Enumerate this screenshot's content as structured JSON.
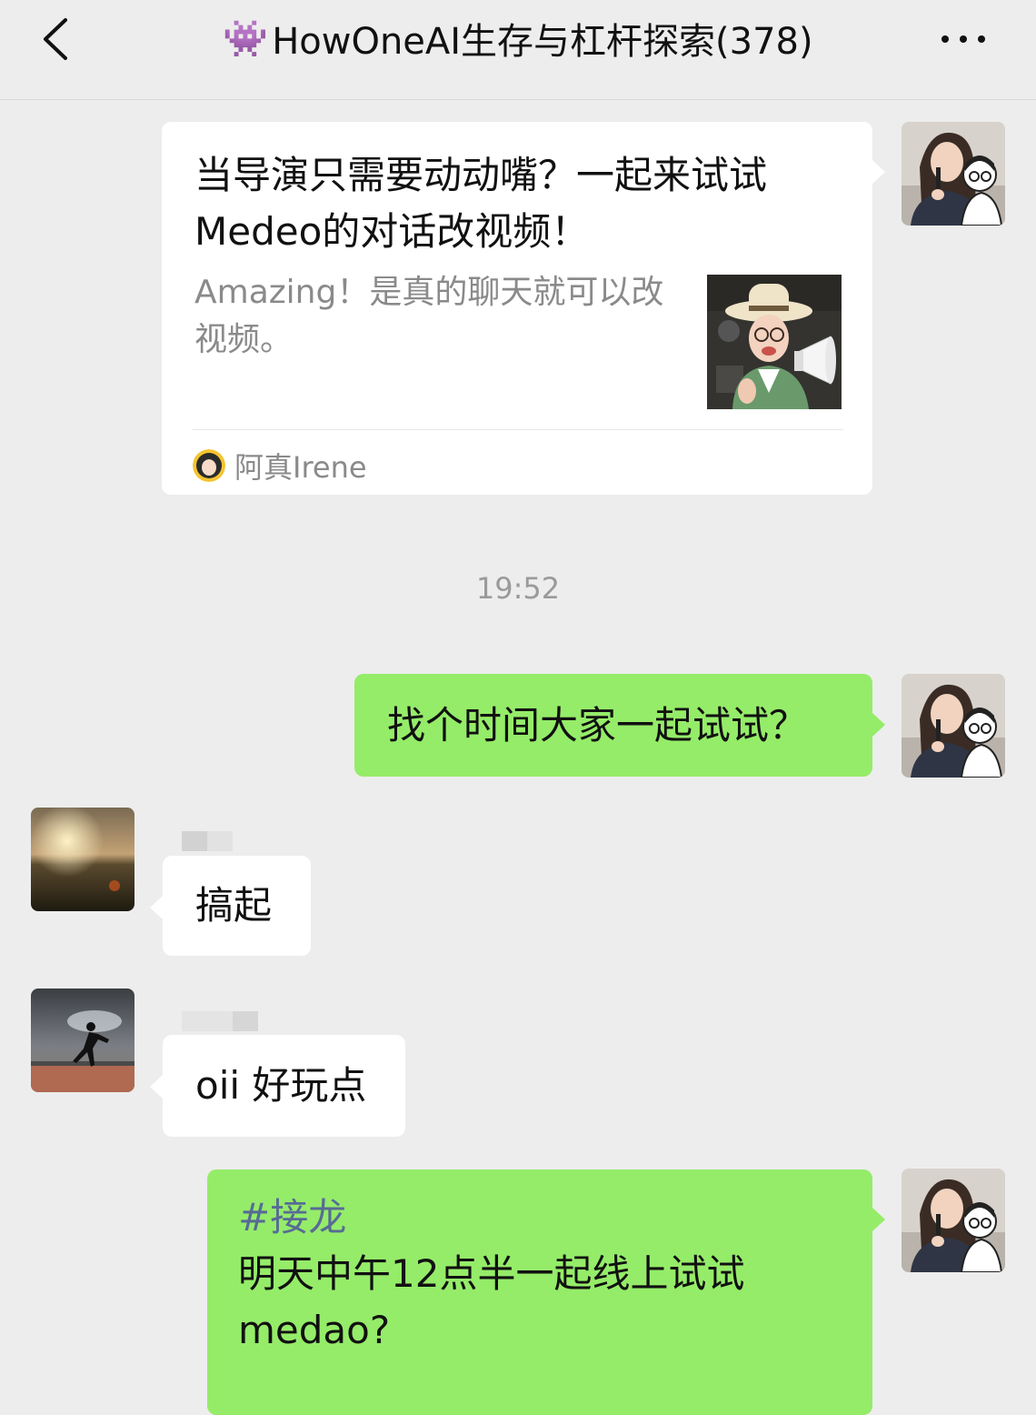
{
  "header": {
    "emoji": "👾",
    "title": "HowOneAI生存与杠杆探索(378)"
  },
  "messages": {
    "card": {
      "title": "当导演只需要动动嘴？一起来试试Medeo的对话改视频！",
      "description": "Amazing！是真的聊天就可以改视频。",
      "source": "阿真Irene"
    },
    "timestamp": "19:52",
    "msg1": {
      "text": "找个时间大家一起试试？"
    },
    "msg2": {
      "text": "搞起"
    },
    "msg3": {
      "text": "oii 好玩点"
    },
    "msg4": {
      "hashtag": "#接龙",
      "line1": "明天中午12点半一起线上试试",
      "line2": "medao?"
    }
  },
  "colors": {
    "background": "#ededed",
    "green_bubble": "#95ec69",
    "white_bubble": "#ffffff",
    "hashtag": "#576b95",
    "timestamp": "#9a9a9a"
  }
}
